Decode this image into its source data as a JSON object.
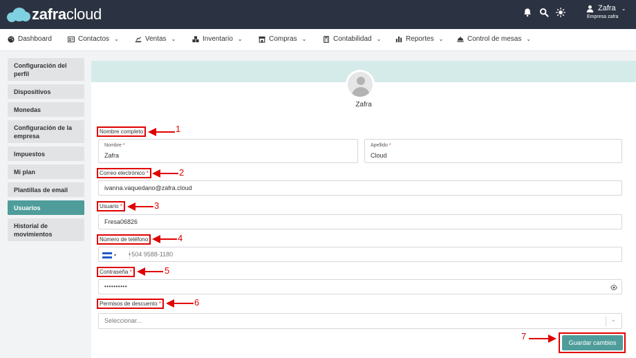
{
  "brand": {
    "name_bold": "zafra",
    "name_light": "cloud"
  },
  "header": {
    "icons": [
      "bell-icon",
      "search-icon",
      "sun-icon"
    ],
    "user_name": "Zafra",
    "user_company": "Empresa zafra"
  },
  "nav": [
    {
      "label": "Dashboard",
      "icon": "palette-icon",
      "dropdown": false
    },
    {
      "label": "Contactos",
      "icon": "contacts-card-icon",
      "dropdown": true
    },
    {
      "label": "Ventas",
      "icon": "sales-icon",
      "dropdown": true
    },
    {
      "label": "Inventario",
      "icon": "boxes-icon",
      "dropdown": true
    },
    {
      "label": "Compras",
      "icon": "store-icon",
      "dropdown": true
    },
    {
      "label": "Contabilidad",
      "icon": "calculator-icon",
      "dropdown": true
    },
    {
      "label": "Reportes",
      "icon": "bar-chart-icon",
      "dropdown": true
    },
    {
      "label": "Control de mesas",
      "icon": "table-service-icon",
      "dropdown": true
    }
  ],
  "sidebar": [
    {
      "label": "Configuración del perfil",
      "active": false
    },
    {
      "label": "Dispositivos",
      "active": false
    },
    {
      "label": "Monedas",
      "active": false
    },
    {
      "label": "Configuración de la empresa",
      "active": false
    },
    {
      "label": "Impuestos",
      "active": false
    },
    {
      "label": "Mi plan",
      "active": false
    },
    {
      "label": "Plantillas de email",
      "active": false
    },
    {
      "label": "Usuarios",
      "active": true
    },
    {
      "label": "Historial de movimientos",
      "active": false
    }
  ],
  "profile": {
    "name": "Zafra"
  },
  "form": {
    "full_name_label": "Nombre completo",
    "first_name_label": "Nombre",
    "first_name_value": "Zafra",
    "last_name_label": "Apellido",
    "last_name_value": "Cloud",
    "email_label": "Correo electrónico",
    "email_value": "ivanna.vaquedano@zafra.cloud",
    "username_label": "Usuario",
    "username_value": "Fresa06826",
    "phone_label": "Número de teléfono",
    "phone_placeholder": "+504 9588-1180",
    "password_label": "Contraseña",
    "password_value": "••••••••••",
    "discount_label": "Permisos de descuento",
    "discount_placeholder": "Seleccionar...",
    "required_mark": "*",
    "save_label": "Guardar cambios"
  },
  "annotations": [
    "1",
    "2",
    "3",
    "4",
    "5",
    "6",
    "7"
  ],
  "colors": {
    "header_bg": "#2b3342",
    "accent": "#4e9d9b",
    "banner": "#d5ebea",
    "annotation": "#e00000",
    "logo": "#7fd0e0"
  }
}
